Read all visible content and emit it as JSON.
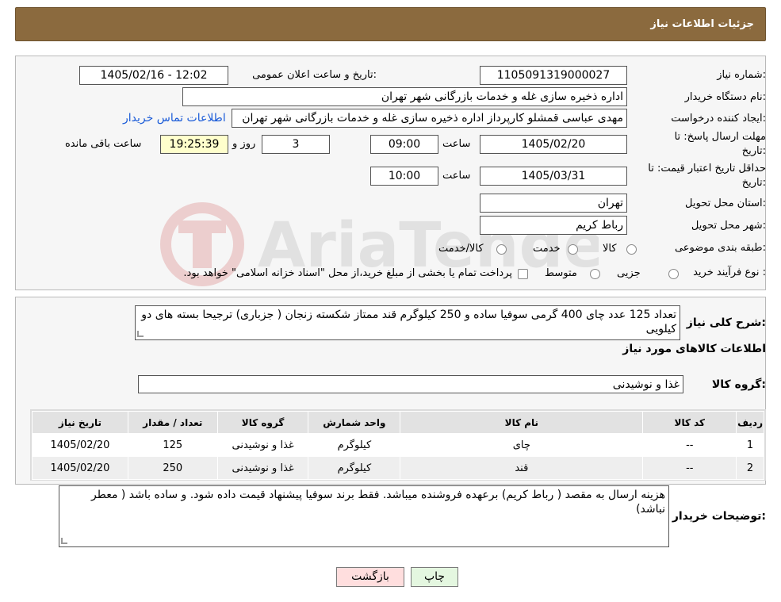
{
  "header": {
    "title": "جزئیات اطلاعات نیاز"
  },
  "form": {
    "need_number_label": "شماره نیاز:",
    "need_number": "1105091319000027",
    "announce_label": "تاریخ و ساعت اعلان عمومی:",
    "announce_value": "1405/02/16 - 12:02",
    "buyer_label": "نام دستگاه خریدار:",
    "buyer_value": "اداره ذخیره سازی غله و خدمات بازرگانی شهر تهران",
    "creator_label": "ایجاد کننده درخواست:",
    "creator_value": "مهدی عباسی قمشلو کارپرداز اداره ذخیره سازی غله و خدمات بازرگانی شهر تهران",
    "contact_link": "اطلاعات تماس خریدار",
    "deadline_label_1": "مهلت ارسال پاسخ: تا",
    "deadline_label_2": "تاریخ:",
    "deadline_date": "1405/02/20",
    "time_label": "ساعت",
    "deadline_time": "09:00",
    "days_value": "3",
    "days_label": "روز و",
    "remaining_time": "19:25:39",
    "remaining_label": "ساعت باقی مانده",
    "validity_label_1": "حداقل تاریخ اعتبار قیمت: تا",
    "validity_label_2": "تاریخ:",
    "validity_date": "1405/03/31",
    "validity_time": "10:00",
    "province_label": "استان محل تحویل:",
    "province_value": "تهران",
    "city_label": "شهر محل تحویل:",
    "city_value": "رباط کریم",
    "category_label": "طبقه بندی موضوعی:",
    "category_options": [
      "کالا",
      "خدمت",
      "کالا/خدمت"
    ],
    "process_label": "نوع فرآیند خرید :",
    "process_options": [
      "جزیی",
      "متوسط"
    ],
    "process_note": "پرداخت تمام یا بخشی از مبلغ خرید،از محل \"اسناد خزانه اسلامی\" خواهد بود."
  },
  "summary": {
    "label": "شرح کلی نیاز:",
    "text": "تعداد 125 عدد چای 400 گرمی سوفیا ساده و 250 کیلوگرم قند ممتاز شکسته زنجان ( جزباری) ترجیحا بسته های دو کیلویی",
    "items_title": "اطلاعات کالاهای مورد نیاز",
    "group_label": "گروه کالا:",
    "group_value": "غذا و نوشیدنی"
  },
  "table": {
    "headers": [
      "ردیف",
      "کد کالا",
      "نام کالا",
      "واحد شمارش",
      "گروه کالا",
      "تعداد / مقدار",
      "تاریخ نیاز"
    ],
    "rows": [
      [
        "1",
        "--",
        "چای",
        "کیلوگرم",
        "غذا و نوشیدنی",
        "125",
        "1405/02/20"
      ],
      [
        "2",
        "--",
        "قند",
        "کیلوگرم",
        "غذا و نوشیدنی",
        "250",
        "1405/02/20"
      ]
    ]
  },
  "notes": {
    "label": "توضیحات خریدار:",
    "text": "هزینه ارسال به مقصد ( رباط کریم) برعهده فروشنده میباشد. فقط برند سوفیا پیشنهاد قیمت داده شود. و ساده باشد ( معطر نباشد)"
  },
  "buttons": {
    "print": "چاپ",
    "back": "بازگشت"
  },
  "colors": {
    "header": "#8b6a3e",
    "back_button": "#ffdede",
    "print_button": "#e4f7e0",
    "link": "#1a5bd8"
  }
}
